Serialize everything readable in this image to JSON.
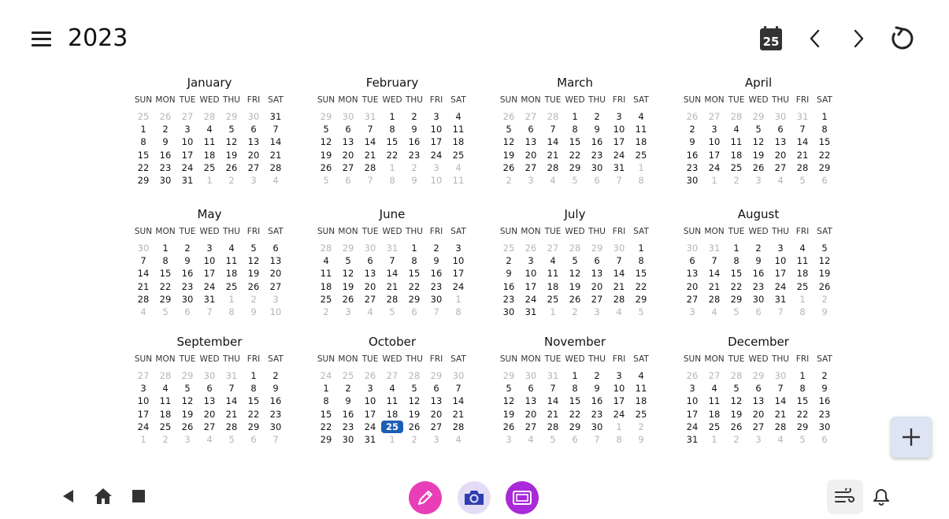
{
  "header": {
    "year": "2023",
    "today_icon_number": "25",
    "icons": [
      "menu-icon",
      "calendar-today-icon",
      "chevron-left-icon",
      "chevron-right-icon",
      "refresh-icon"
    ]
  },
  "weekdays": [
    "SUN",
    "MON",
    "TUE",
    "WED",
    "THU",
    "FRI",
    "SAT"
  ],
  "today": {
    "month_index": 9,
    "day": "25"
  },
  "months": [
    {
      "name": "January",
      "weeks": [
        [
          "25",
          "26",
          "27",
          "28",
          "29",
          "30",
          "31"
        ],
        [
          "1",
          "2",
          "3",
          "4",
          "5",
          "6",
          "7"
        ],
        [
          "8",
          "9",
          "10",
          "11",
          "12",
          "13",
          "14"
        ],
        [
          "15",
          "16",
          "17",
          "18",
          "19",
          "20",
          "21"
        ],
        [
          "22",
          "23",
          "24",
          "25",
          "26",
          "27",
          "28"
        ],
        [
          "29",
          "30",
          "31",
          "1",
          "2",
          "3",
          "4"
        ]
      ],
      "lead": 6,
      "trail": 4
    },
    {
      "name": "February",
      "weeks": [
        [
          "29",
          "30",
          "31",
          "1",
          "2",
          "3",
          "4"
        ],
        [
          "5",
          "6",
          "7",
          "8",
          "9",
          "10",
          "11"
        ],
        [
          "12",
          "13",
          "14",
          "15",
          "16",
          "17",
          "18"
        ],
        [
          "19",
          "20",
          "21",
          "22",
          "23",
          "24",
          "25"
        ],
        [
          "26",
          "27",
          "28",
          "1",
          "2",
          "3",
          "4"
        ],
        [
          "5",
          "6",
          "7",
          "8",
          "9",
          "10",
          "11"
        ]
      ],
      "lead": 3,
      "trail": 11
    },
    {
      "name": "March",
      "weeks": [
        [
          "26",
          "27",
          "28",
          "1",
          "2",
          "3",
          "4"
        ],
        [
          "5",
          "6",
          "7",
          "8",
          "9",
          "10",
          "11"
        ],
        [
          "12",
          "13",
          "14",
          "15",
          "16",
          "17",
          "18"
        ],
        [
          "19",
          "20",
          "21",
          "22",
          "23",
          "24",
          "25"
        ],
        [
          "26",
          "27",
          "28",
          "29",
          "30",
          "31",
          "1"
        ],
        [
          "2",
          "3",
          "4",
          "5",
          "6",
          "7",
          "8"
        ]
      ],
      "lead": 3,
      "trail": 8
    },
    {
      "name": "April",
      "weeks": [
        [
          "26",
          "27",
          "28",
          "29",
          "30",
          "31",
          "1"
        ],
        [
          "2",
          "3",
          "4",
          "5",
          "6",
          "7",
          "8"
        ],
        [
          "9",
          "10",
          "11",
          "12",
          "13",
          "14",
          "15"
        ],
        [
          "16",
          "17",
          "18",
          "19",
          "20",
          "21",
          "22"
        ],
        [
          "23",
          "24",
          "25",
          "26",
          "27",
          "28",
          "29"
        ],
        [
          "30",
          "1",
          "2",
          "3",
          "4",
          "5",
          "6"
        ]
      ],
      "lead": 6,
      "trail": 6
    },
    {
      "name": "May",
      "weeks": [
        [
          "30",
          "1",
          "2",
          "3",
          "4",
          "5",
          "6"
        ],
        [
          "7",
          "8",
          "9",
          "10",
          "11",
          "12",
          "13"
        ],
        [
          "14",
          "15",
          "16",
          "17",
          "18",
          "19",
          "20"
        ],
        [
          "21",
          "22",
          "23",
          "24",
          "25",
          "26",
          "27"
        ],
        [
          "28",
          "29",
          "30",
          "31",
          "1",
          "2",
          "3"
        ],
        [
          "4",
          "5",
          "6",
          "7",
          "8",
          "9",
          "10"
        ]
      ],
      "lead": 1,
      "trail": 10
    },
    {
      "name": "June",
      "weeks": [
        [
          "28",
          "29",
          "30",
          "31",
          "1",
          "2",
          "3"
        ],
        [
          "4",
          "5",
          "6",
          "7",
          "8",
          "9",
          "10"
        ],
        [
          "11",
          "12",
          "13",
          "14",
          "15",
          "16",
          "17"
        ],
        [
          "18",
          "19",
          "20",
          "21",
          "22",
          "23",
          "24"
        ],
        [
          "25",
          "26",
          "27",
          "28",
          "29",
          "30",
          "1"
        ],
        [
          "2",
          "3",
          "4",
          "5",
          "6",
          "7",
          "8"
        ]
      ],
      "lead": 4,
      "trail": 8
    },
    {
      "name": "July",
      "weeks": [
        [
          "25",
          "26",
          "27",
          "28",
          "29",
          "30",
          "1"
        ],
        [
          "2",
          "3",
          "4",
          "5",
          "6",
          "7",
          "8"
        ],
        [
          "9",
          "10",
          "11",
          "12",
          "13",
          "14",
          "15"
        ],
        [
          "16",
          "17",
          "18",
          "19",
          "20",
          "21",
          "22"
        ],
        [
          "23",
          "24",
          "25",
          "26",
          "27",
          "28",
          "29"
        ],
        [
          "30",
          "31",
          "1",
          "2",
          "3",
          "4",
          "5"
        ]
      ],
      "lead": 6,
      "trail": 5
    },
    {
      "name": "August",
      "weeks": [
        [
          "30",
          "31",
          "1",
          "2",
          "3",
          "4",
          "5"
        ],
        [
          "6",
          "7",
          "8",
          "9",
          "10",
          "11",
          "12"
        ],
        [
          "13",
          "14",
          "15",
          "16",
          "17",
          "18",
          "19"
        ],
        [
          "20",
          "21",
          "22",
          "23",
          "24",
          "25",
          "26"
        ],
        [
          "27",
          "28",
          "29",
          "30",
          "31",
          "1",
          "2"
        ],
        [
          "3",
          "4",
          "5",
          "6",
          "7",
          "8",
          "9"
        ]
      ],
      "lead": 2,
      "trail": 9
    },
    {
      "name": "September",
      "weeks": [
        [
          "27",
          "28",
          "29",
          "30",
          "31",
          "1",
          "2"
        ],
        [
          "3",
          "4",
          "5",
          "6",
          "7",
          "8",
          "9"
        ],
        [
          "10",
          "11",
          "12",
          "13",
          "14",
          "15",
          "16"
        ],
        [
          "17",
          "18",
          "19",
          "20",
          "21",
          "22",
          "23"
        ],
        [
          "24",
          "25",
          "26",
          "27",
          "28",
          "29",
          "30"
        ],
        [
          "1",
          "2",
          "3",
          "4",
          "5",
          "6",
          "7"
        ]
      ],
      "lead": 5,
      "trail": 7
    },
    {
      "name": "October",
      "weeks": [
        [
          "24",
          "25",
          "26",
          "27",
          "28",
          "29",
          "30"
        ],
        [
          "1",
          "2",
          "3",
          "4",
          "5",
          "6",
          "7"
        ],
        [
          "8",
          "9",
          "10",
          "11",
          "12",
          "13",
          "14"
        ],
        [
          "15",
          "16",
          "17",
          "18",
          "19",
          "20",
          "21"
        ],
        [
          "22",
          "23",
          "24",
          "25",
          "26",
          "27",
          "28"
        ],
        [
          "29",
          "30",
          "31",
          "1",
          "2",
          "3",
          "4"
        ]
      ],
      "lead": 7,
      "trail": 4
    },
    {
      "name": "November",
      "weeks": [
        [
          "29",
          "30",
          "31",
          "1",
          "2",
          "3",
          "4"
        ],
        [
          "5",
          "6",
          "7",
          "8",
          "9",
          "10",
          "11"
        ],
        [
          "12",
          "13",
          "14",
          "15",
          "16",
          "17",
          "18"
        ],
        [
          "19",
          "20",
          "21",
          "22",
          "23",
          "24",
          "25"
        ],
        [
          "26",
          "27",
          "28",
          "29",
          "30",
          "1",
          "2"
        ],
        [
          "3",
          "4",
          "5",
          "6",
          "7",
          "8",
          "9"
        ]
      ],
      "lead": 3,
      "trail": 9
    },
    {
      "name": "December",
      "weeks": [
        [
          "26",
          "27",
          "28",
          "29",
          "30",
          "1",
          "2"
        ],
        [
          "3",
          "4",
          "5",
          "6",
          "7",
          "8",
          "9"
        ],
        [
          "10",
          "11",
          "12",
          "13",
          "14",
          "15",
          "16"
        ],
        [
          "17",
          "18",
          "19",
          "20",
          "21",
          "22",
          "23"
        ],
        [
          "24",
          "25",
          "26",
          "27",
          "28",
          "29",
          "30"
        ],
        [
          "31",
          "1",
          "2",
          "3",
          "4",
          "5",
          "6"
        ]
      ],
      "lead": 5,
      "trail": 6
    }
  ],
  "fab": {
    "icon": "plus-icon"
  },
  "navbar": {
    "icons": [
      "back-icon",
      "home-icon",
      "recents-icon",
      "pen-app-icon",
      "camera-app-icon",
      "screen-app-icon",
      "wind-settings-icon",
      "bell-icon"
    ],
    "colors": {
      "pen": "#e83fb8",
      "camera": "#e4dcf7",
      "screen": "#a92ad8"
    }
  },
  "colors": {
    "today_highlight": "#1a5fb4",
    "outside_day": "#b5b5b5",
    "fab_bg": "#dde4f3"
  }
}
